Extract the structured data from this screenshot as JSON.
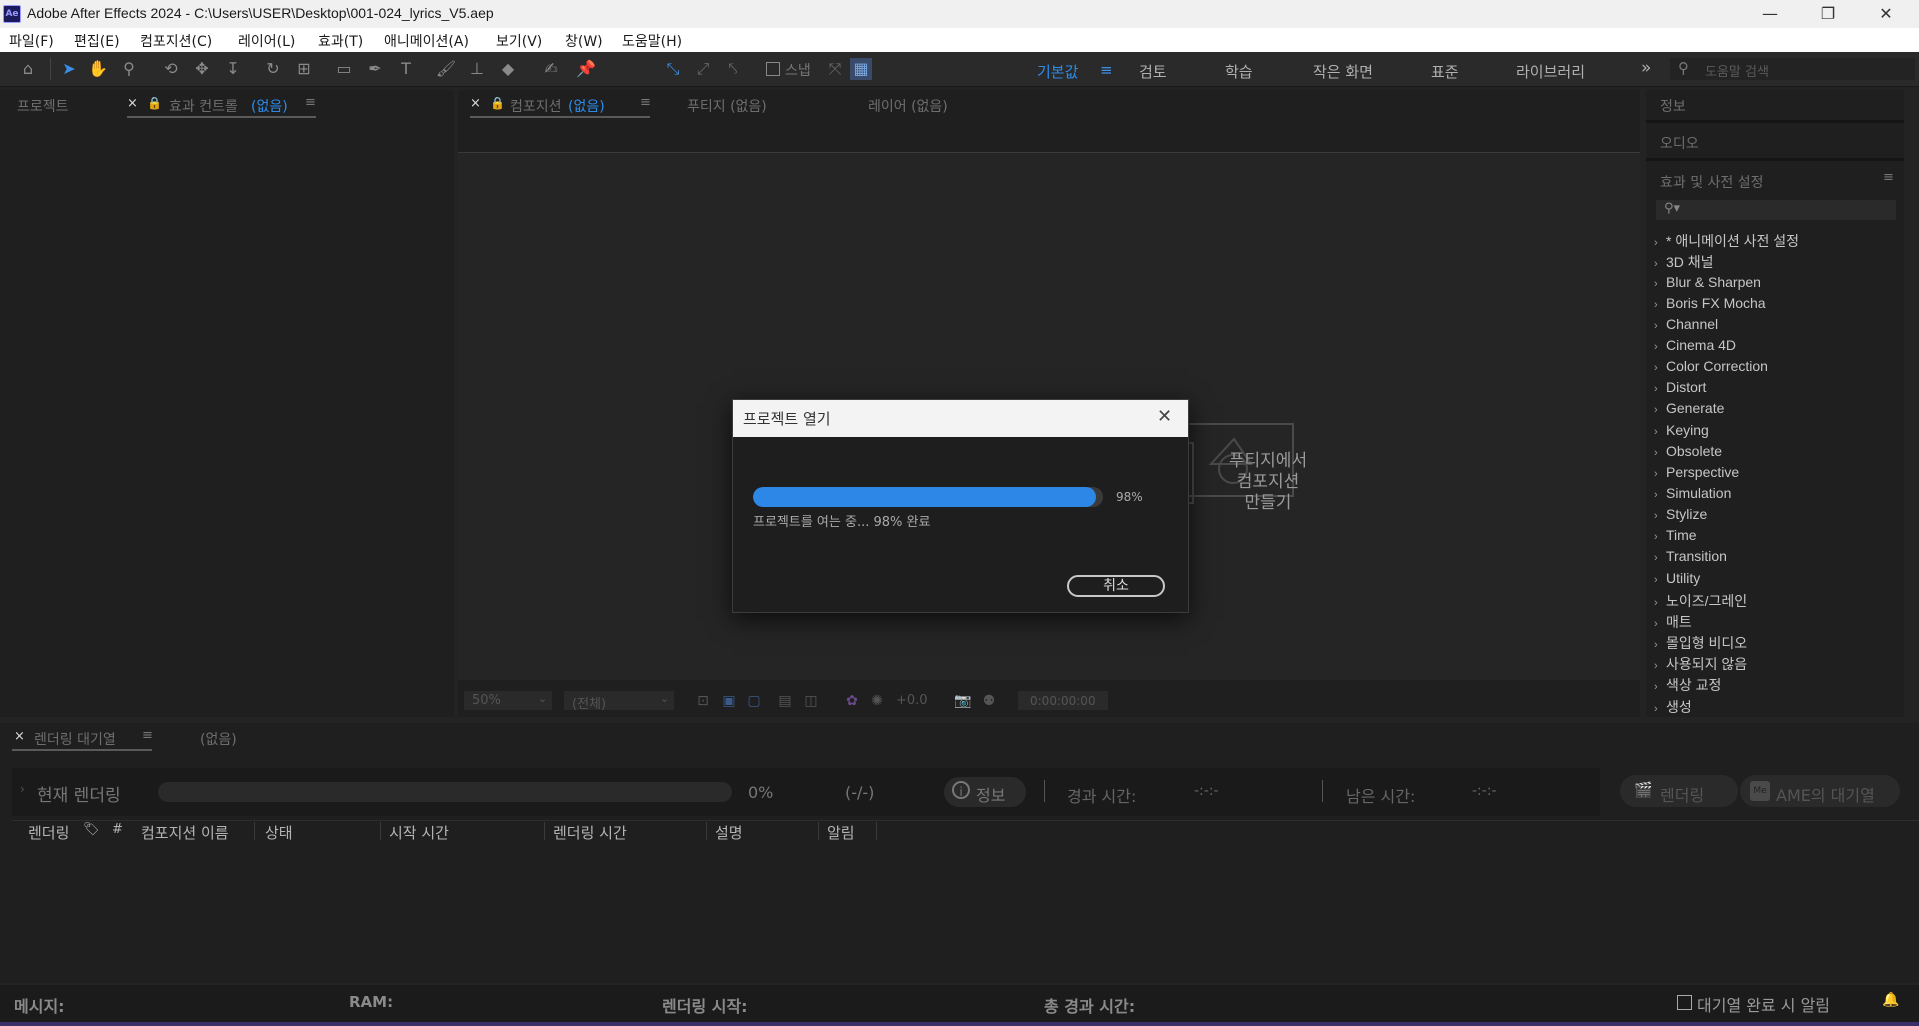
{
  "window": {
    "app_icon": "Ae",
    "title": "Adobe After Effects 2024 - C:\\Users\\USER\\Desktop\\001-024_lyrics_V5.aep",
    "minimize": "—",
    "restore": "❐",
    "close": "✕"
  },
  "menu": [
    "파일(F)",
    "편집(E)",
    "컴포지션(C)",
    "레이어(L)",
    "효과(T)",
    "애니메이션(A)",
    "보기(V)",
    "창(W)",
    "도움말(H)"
  ],
  "toolbar": {
    "snap_label": "스냅",
    "workspaces": [
      "기본값",
      "검토",
      "학습",
      "작은 화면",
      "표준",
      "라이브러리"
    ],
    "active_workspace": "기본값",
    "more": "»",
    "search_placeholder": "도움말 검색"
  },
  "left_panel": {
    "tab_project": "프로젝트",
    "tab_effects_controls": "효과 컨트롤",
    "tab_effects_controls_value": "(없음)"
  },
  "center_panel": {
    "tab_composition": "컴포지션",
    "tab_composition_value": "(없음)",
    "tab_footage": "푸티지 (없음)",
    "tab_layer": "레이어 (없음)",
    "placeholder_text": [
      "푸티지에서",
      "컴포지션",
      "만들기"
    ],
    "viewer_bar": {
      "zoom": "50%",
      "resolution": "(전체)",
      "exposure": "+0.0",
      "timecode": "0:00:00:00"
    }
  },
  "right_panel": {
    "tab_info": "정보",
    "tab_audio": "오디오",
    "tab_effects_presets": "효과 및 사전 설정",
    "effects": [
      "* 애니메이션 사전 설정",
      "3D 채널",
      "Blur & Sharpen",
      "Boris FX Mocha",
      "Channel",
      "Cinema 4D",
      "Color Correction",
      "Distort",
      "Generate",
      "Keying",
      "Obsolete",
      "Perspective",
      "Simulation",
      "Stylize",
      "Time",
      "Transition",
      "Utility",
      "노이즈/그레인",
      "매트",
      "몰입형 비디오",
      "사용되지 않음",
      "색상 교정",
      "생성"
    ]
  },
  "render_queue": {
    "tab": "렌더링 대기열",
    "tab_value": "(없음)",
    "current_render": "현재 렌더링",
    "percent": "0%",
    "count": "(-/-)",
    "info_button": "정보",
    "elapsed_label": "경과 시간:",
    "elapsed_value": "-:-:-",
    "remaining_label": "남은 시간:",
    "remaining_value": "-:-:-",
    "render_button": "렌더링",
    "ame_button": "AME의 대기열",
    "columns": [
      "렌더링",
      "#",
      "컴포지션 이름",
      "상태",
      "시작 시간",
      "렌더링 시간",
      "설명",
      "알림"
    ]
  },
  "status_bar": {
    "message": "메시지:",
    "ram": "RAM:",
    "render_start": "렌더링 시작:",
    "total_elapsed": "총 경과 시간:",
    "notify": "대기열 완료 시 알림"
  },
  "dialog": {
    "title": "프로젝트 열기",
    "progress": 0.98,
    "percent_label": "98%",
    "status_text": "프로젝트를 여는 중... 98% 완료",
    "cancel": "취소"
  },
  "colors": {
    "accent": "#2d8ceb",
    "progress_fill": "#2d87e6",
    "background": "#232323"
  }
}
